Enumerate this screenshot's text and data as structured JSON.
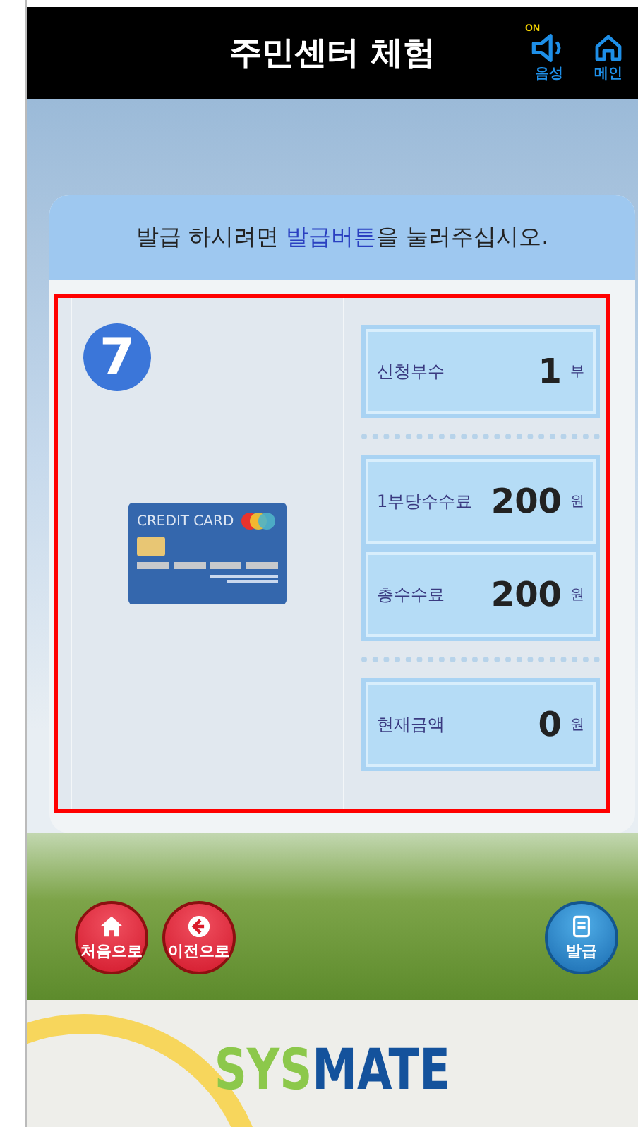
{
  "header": {
    "title": "주민센터 체험",
    "sound": {
      "badge": "ON",
      "label": "음성"
    },
    "home": {
      "label": "메인"
    }
  },
  "panel": {
    "instruction": {
      "before": "발급 하시려면 ",
      "highlight": "발급버튼",
      "after": "을 눌러주십시오."
    },
    "step": "7",
    "card_label": "CREDIT CARD",
    "rows": [
      {
        "label": "신청부수",
        "value": "1",
        "unit": "부",
        "divider_after": true
      },
      {
        "label": "1부당수수료",
        "value": "200",
        "unit": "원",
        "divider_after": false
      },
      {
        "label": "총수수료",
        "value": "200",
        "unit": "원",
        "divider_after": true
      },
      {
        "label": "현재금액",
        "value": "0",
        "unit": "원",
        "divider_after": false
      }
    ]
  },
  "nav": [
    {
      "kind": "home",
      "label": "처음으로"
    },
    {
      "kind": "back",
      "label": "이전으로"
    },
    {
      "kind": "issue",
      "label": "발급"
    }
  ],
  "logo": {
    "parts": [
      "SYS",
      "MATE"
    ]
  }
}
